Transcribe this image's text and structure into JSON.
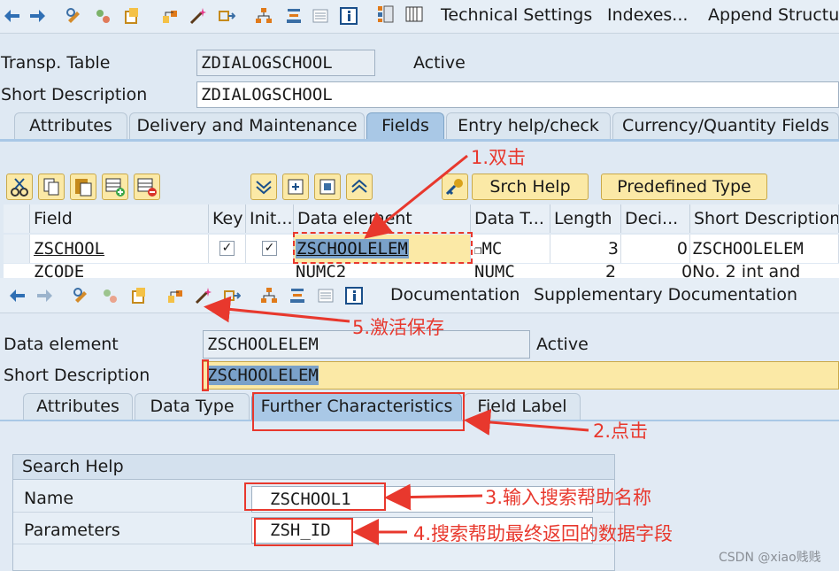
{
  "top_toolbar": {
    "technical_settings": "Technical Settings",
    "indexes": "Indexes...",
    "append_structure": "Append Structure"
  },
  "table_header": {
    "transp_table_label": "Transp. Table",
    "transp_table_value": "ZDIALOGSCHOOL",
    "status": "Active",
    "short_desc_label": "Short Description",
    "short_desc_value": "ZDIALOGSCHOOL"
  },
  "table_tabs": [
    "Attributes",
    "Delivery and Maintenance",
    "Fields",
    "Entry help/check",
    "Currency/Quantity Fields"
  ],
  "field_toolbar": {
    "srch_help": "Srch Help",
    "predefined_type": "Predefined Type"
  },
  "grid": {
    "headers": [
      "Field",
      "Key",
      "Init...",
      "Data element",
      "Data T...",
      "Length",
      "Deci...",
      "Short Description"
    ],
    "row1": {
      "field": "ZSCHOOL",
      "data_element": "ZSCHOOLELEM",
      "data_type": "MC",
      "length": "3",
      "decimals": "0",
      "short_desc": "ZSCHOOLELEM"
    },
    "row2": {
      "field": "ZCODE",
      "data_element": "NUMC2",
      "data_type": "NUMC",
      "length": "2",
      "decimals": "0",
      "short_desc": "No. 2 int and"
    }
  },
  "de_toolbar": {
    "documentation": "Documentation",
    "supplementary": "Supplementary Documentation"
  },
  "data_element": {
    "label": "Data element",
    "value": "ZSCHOOLELEM",
    "status": "Active",
    "short_desc_label": "Short Description",
    "short_desc_value": "ZSCHOOLELEM"
  },
  "de_tabs": [
    "Attributes",
    "Data Type",
    "Further Characteristics",
    "Field Label"
  ],
  "search_help": {
    "title": "Search Help",
    "name_label": "Name",
    "name_value": "ZSCHOOL1",
    "params_label": "Parameters",
    "params_value": "ZSH_ID"
  },
  "annotations": {
    "a1": "1.双击",
    "a2": "2.点击",
    "a3": "3.输入搜索帮助名称",
    "a4": "4.搜索帮助最终返回的数据字段",
    "a5": "5.激活保存"
  },
  "watermark": "CSDN @xiao贱贱",
  "colors": {
    "annotation": "#e8382d",
    "highlight": "#fbe9a6",
    "active_tab": "#a9c8e6"
  }
}
